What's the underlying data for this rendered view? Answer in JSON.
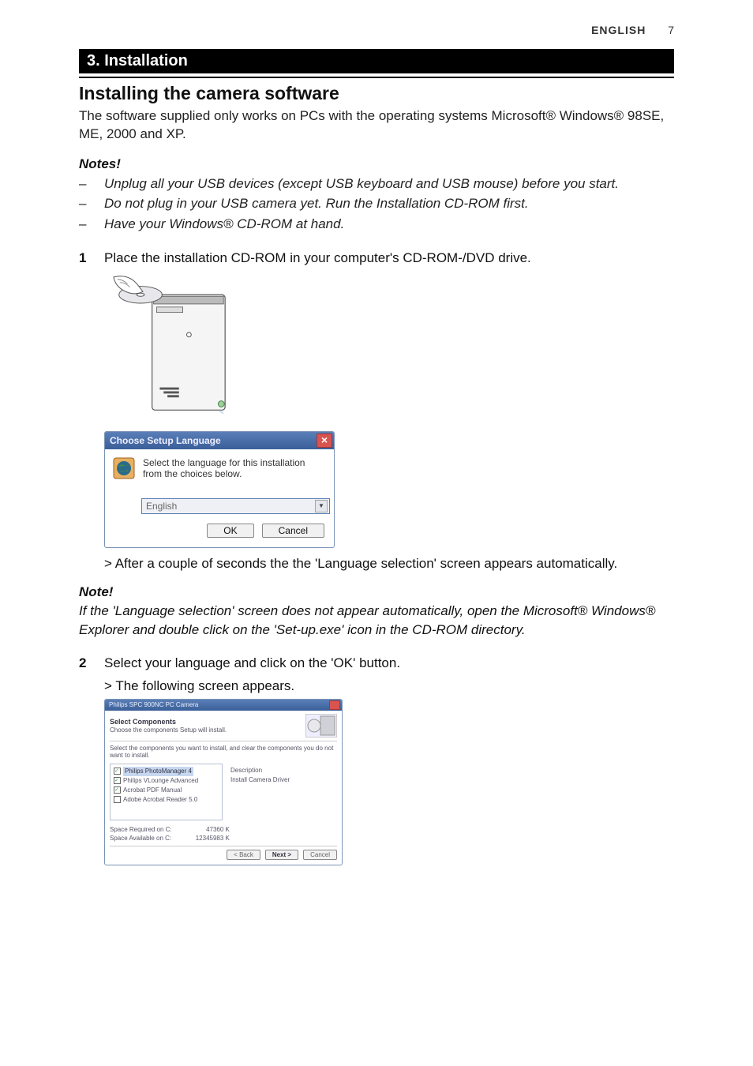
{
  "header": {
    "lang_label": "ENGLISH",
    "page_number": "7"
  },
  "section_bar": "3. Installation",
  "subsection_title": "Installing the camera software",
  "intro_paragraph": "The software supplied only works on PCs with the operating systems Microsoft® Windows® 98SE, ME, 2000 and XP.",
  "notes_title": "Notes!",
  "notes": [
    "Unplug all your USB devices (except USB keyboard and USB mouse) before you start.",
    "Do not plug in your USB camera yet. Run the Installation CD-ROM first.",
    "Have your Windows® CD-ROM at hand."
  ],
  "steps": {
    "1": {
      "num": "1",
      "text": "Place the installation CD-ROM in your computer's CD-ROM-/DVD drive.",
      "result": "> After a couple of seconds the the 'Language selection' screen appears automatically."
    },
    "2": {
      "num": "2",
      "text": "Select your language and click on the 'OK' button.",
      "result": "> The following screen appears."
    }
  },
  "mid_note": {
    "title": "Note!",
    "body": "If the 'Language selection' screen does not appear automatically, open the Microsoft® Windows® Explorer and double click on the 'Set-up.exe' icon in the CD-ROM directory."
  },
  "dialog_language": {
    "title": "Choose Setup Language",
    "message": "Select the language for this installation from the choices below.",
    "selected": "English",
    "ok": "OK",
    "cancel": "Cancel"
  },
  "dialog_components": {
    "title": "Philips SPC 900NC PC Camera",
    "heading": "Select Components",
    "sub": "Choose the components Setup will install.",
    "intro": "Select the components you want to install, and clear the components you do not want to install.",
    "items": [
      "Philips PhotoManager 4",
      "Philips VLounge Advanced",
      "Acrobat PDF Manual",
      "Adobe Acrobat Reader 5.0"
    ],
    "first_checked": true,
    "desc_label": "Description",
    "desc_text": "Install Camera Driver",
    "space_req_label": "Space Required on C:",
    "space_req_val": "47360 K",
    "space_avail_label": "Space Available on C:",
    "space_avail_val": "12345983 K",
    "back": "< Back",
    "next": "Next >",
    "cancel": "Cancel"
  }
}
